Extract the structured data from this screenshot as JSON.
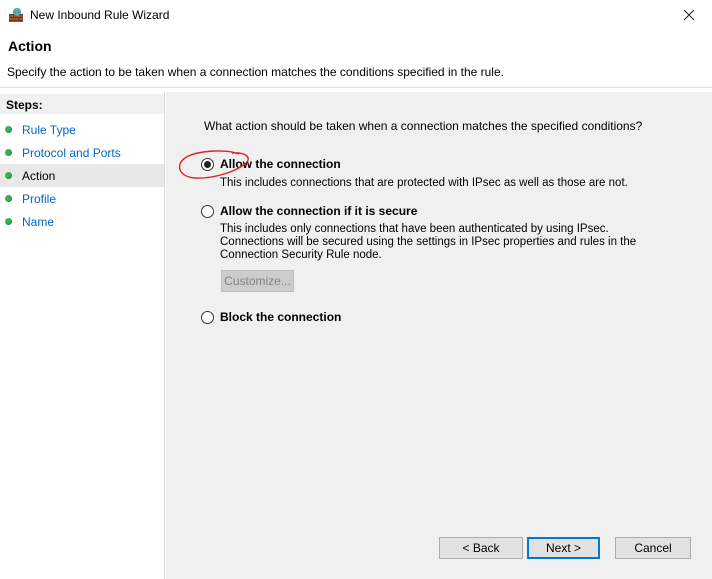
{
  "window": {
    "title": "New Inbound Rule Wizard"
  },
  "header": {
    "title": "Action",
    "description": "Specify the action to be taken when a connection matches the conditions specified in the rule."
  },
  "steps": {
    "label": "Steps:",
    "items": [
      {
        "label": "Rule Type"
      },
      {
        "label": "Protocol and Ports"
      },
      {
        "label": "Action"
      },
      {
        "label": "Profile"
      },
      {
        "label": "Name"
      }
    ],
    "active_index": 2
  },
  "content": {
    "question": "What action should be taken when a connection matches the specified conditions?",
    "options": [
      {
        "label": "Allow the connection",
        "desc": "This includes connections that are protected with IPsec as well as those are not.",
        "checked": true
      },
      {
        "label": "Allow the connection if it is secure",
        "desc": "This includes only connections that have been authenticated by using IPsec.  Connections will be secured using the settings in IPsec properties and rules in the Connection Security Rule node.",
        "checked": false
      },
      {
        "label": "Block the connection",
        "desc": "",
        "checked": false
      }
    ],
    "customize_label": "Customize..."
  },
  "footer": {
    "back_label": "< Back",
    "next_label": "Next >",
    "cancel_label": "Cancel"
  },
  "colors": {
    "step_dot": "#37b24d",
    "link": "#0066cc",
    "annotation": "#e0202a",
    "focus": "#0078d7"
  }
}
